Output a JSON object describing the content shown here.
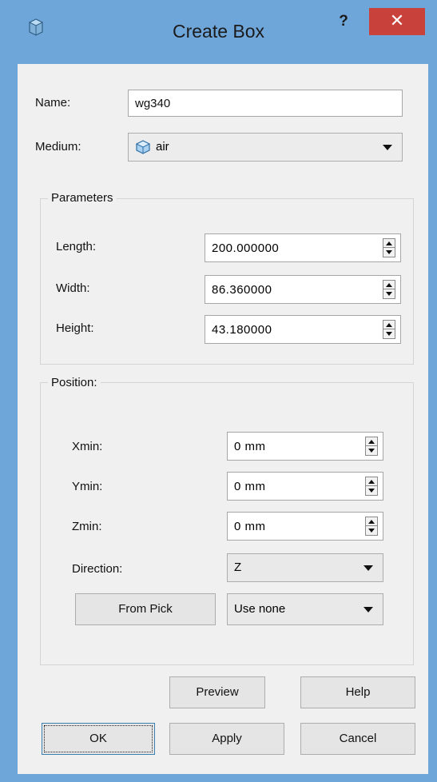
{
  "window": {
    "title": "Create Box",
    "help_label": "?",
    "close_label": "✕",
    "accent": "#6fa6da",
    "close_color": "#c8413a"
  },
  "form": {
    "name_label": "Name:",
    "name_value": "wg340",
    "medium_label": "Medium:",
    "medium_value": "air"
  },
  "parameters": {
    "title": "Parameters",
    "length_label": "Length:",
    "length_value": "200.000000",
    "width_label": "Width:",
    "width_value": "86.360000",
    "height_label": "Height:",
    "height_value": "43.180000"
  },
  "position": {
    "title": "Position:",
    "xmin_label": "Xmin:",
    "xmin_value": "0 mm",
    "ymin_label": "Ymin:",
    "ymin_value": "0 mm",
    "zmin_label": "Zmin:",
    "zmin_value": "0 mm",
    "direction_label": "Direction:",
    "direction_value": "Z",
    "from_pick_label": "From Pick",
    "use_value": "Use none"
  },
  "buttons": {
    "preview": "Preview",
    "help": "Help",
    "ok": "OK",
    "apply": "Apply",
    "cancel": "Cancel"
  }
}
